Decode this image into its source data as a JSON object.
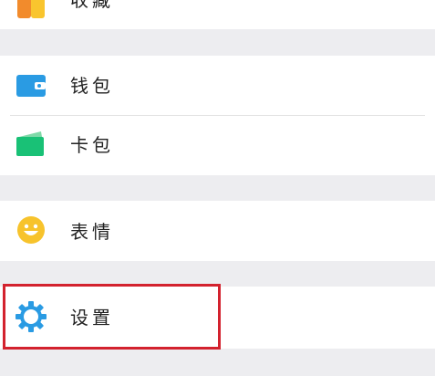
{
  "menu": {
    "items": [
      {
        "label": "收藏",
        "icon": "favorites-icon"
      },
      {
        "label": "钱包",
        "icon": "wallet-icon"
      },
      {
        "label": "卡包",
        "icon": "card-wallet-icon"
      },
      {
        "label": "表情",
        "icon": "emoji-smile-icon"
      },
      {
        "label": "设置",
        "icon": "settings-gear-icon"
      }
    ]
  },
  "colors": {
    "background": "#ededf0",
    "row_background": "#ffffff",
    "accent_blue": "#2a9be3",
    "card_green": "#19c176",
    "emoji_yellow": "#f7c32c",
    "favorites_orange": "#f28b2c",
    "favorites_yellow": "#f9c52e",
    "highlight_red": "#d3222e"
  }
}
